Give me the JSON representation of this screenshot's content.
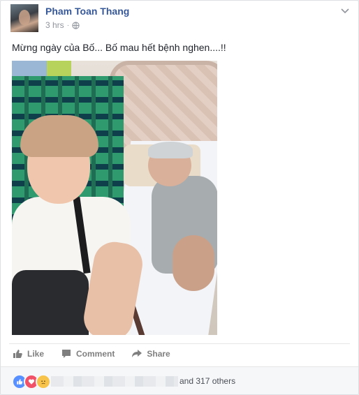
{
  "post": {
    "author": "Pham Toan Thang",
    "time": "3 hrs",
    "separator": "·",
    "text": "Mừng ngày của Bố... Bố mau hết bệnh nghen....!!"
  },
  "actions": {
    "like": "Like",
    "comment": "Comment",
    "share": "Share"
  },
  "reactions": {
    "icons": [
      "like-icon",
      "love-icon",
      "sad-icon"
    ],
    "summary": "and 317 others"
  },
  "colors": {
    "link": "#365899",
    "muted": "#90949c",
    "like_blue": "#5890ff",
    "love_red": "#f25268"
  }
}
